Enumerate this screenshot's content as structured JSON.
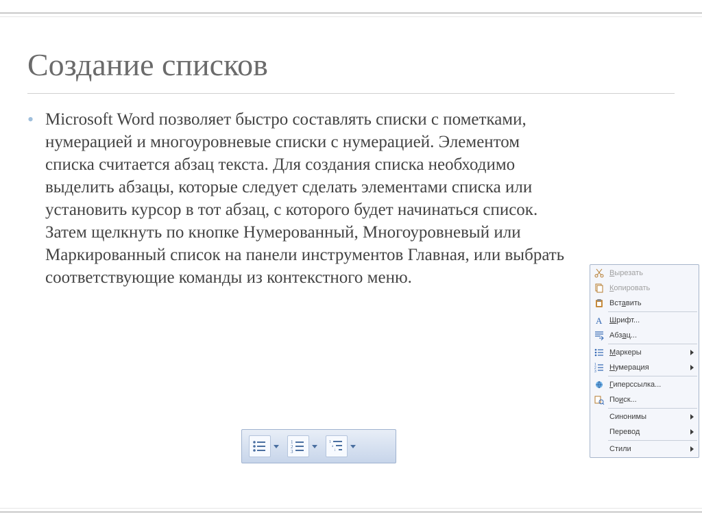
{
  "title": "Создание списков",
  "body": {
    "bullet_1": "Microsoft Word позволяет быстро составлять списки с пометками, нумерацией и многоуровневые списки с нумерацией. Элементом списка считается абзац текста. Для создания списка необходимо выделить абзацы, которые следует сделать элементами списка или установить курсор в тот абзац, с которого будет начинаться список. Затем щелкнуть по кнопке Нумерованный, Многоуровневый или Маркированный список на панели инструментов Главная, или выбрать соответствующие команды из контекстного меню."
  },
  "context_menu": {
    "items": [
      {
        "icon": "scissors-icon",
        "label": "Вырезать",
        "underline_index": 0,
        "disabled": true,
        "submenu": false
      },
      {
        "icon": "copy-icon",
        "label": "Копировать",
        "underline_index": 0,
        "disabled": true,
        "submenu": false
      },
      {
        "icon": "paste-icon",
        "label": "Вставить",
        "underline_index": 3,
        "disabled": false,
        "submenu": false
      },
      {
        "sep": true
      },
      {
        "icon": "font-icon",
        "label": "Шрифт...",
        "underline_index": 0,
        "disabled": false,
        "submenu": false
      },
      {
        "icon": "paragraph-icon",
        "label": "Абзац...",
        "underline_index": 3,
        "disabled": false,
        "submenu": false
      },
      {
        "sep": true
      },
      {
        "icon": "bullets-icon",
        "label": "Маркеры",
        "underline_index": 0,
        "disabled": false,
        "submenu": true
      },
      {
        "icon": "numbering-icon",
        "label": "Нумерация",
        "underline_index": 0,
        "disabled": false,
        "submenu": true
      },
      {
        "sep": true
      },
      {
        "icon": "hyperlink-icon",
        "label": "Гиперссылка...",
        "underline_index": 0,
        "disabled": false,
        "submenu": false
      },
      {
        "icon": "search-icon",
        "label": "Поиск...",
        "underline_index": 2,
        "disabled": false,
        "submenu": false
      },
      {
        "sep": true
      },
      {
        "icon": "",
        "label": "Синонимы",
        "underline_index": -1,
        "disabled": false,
        "submenu": true
      },
      {
        "icon": "",
        "label": "Перевод",
        "underline_index": -1,
        "disabled": false,
        "submenu": true
      },
      {
        "sep": true
      },
      {
        "icon": "",
        "label": "Стили",
        "underline_index": -1,
        "disabled": false,
        "submenu": true
      }
    ]
  },
  "toolbar": {
    "buttons": [
      {
        "name": "bulleted-list-button",
        "icon": "bulleted-list-icon"
      },
      {
        "name": "numbered-list-button",
        "icon": "numbered-list-icon"
      },
      {
        "name": "multilevel-list-button",
        "icon": "multilevel-list-icon"
      }
    ]
  }
}
